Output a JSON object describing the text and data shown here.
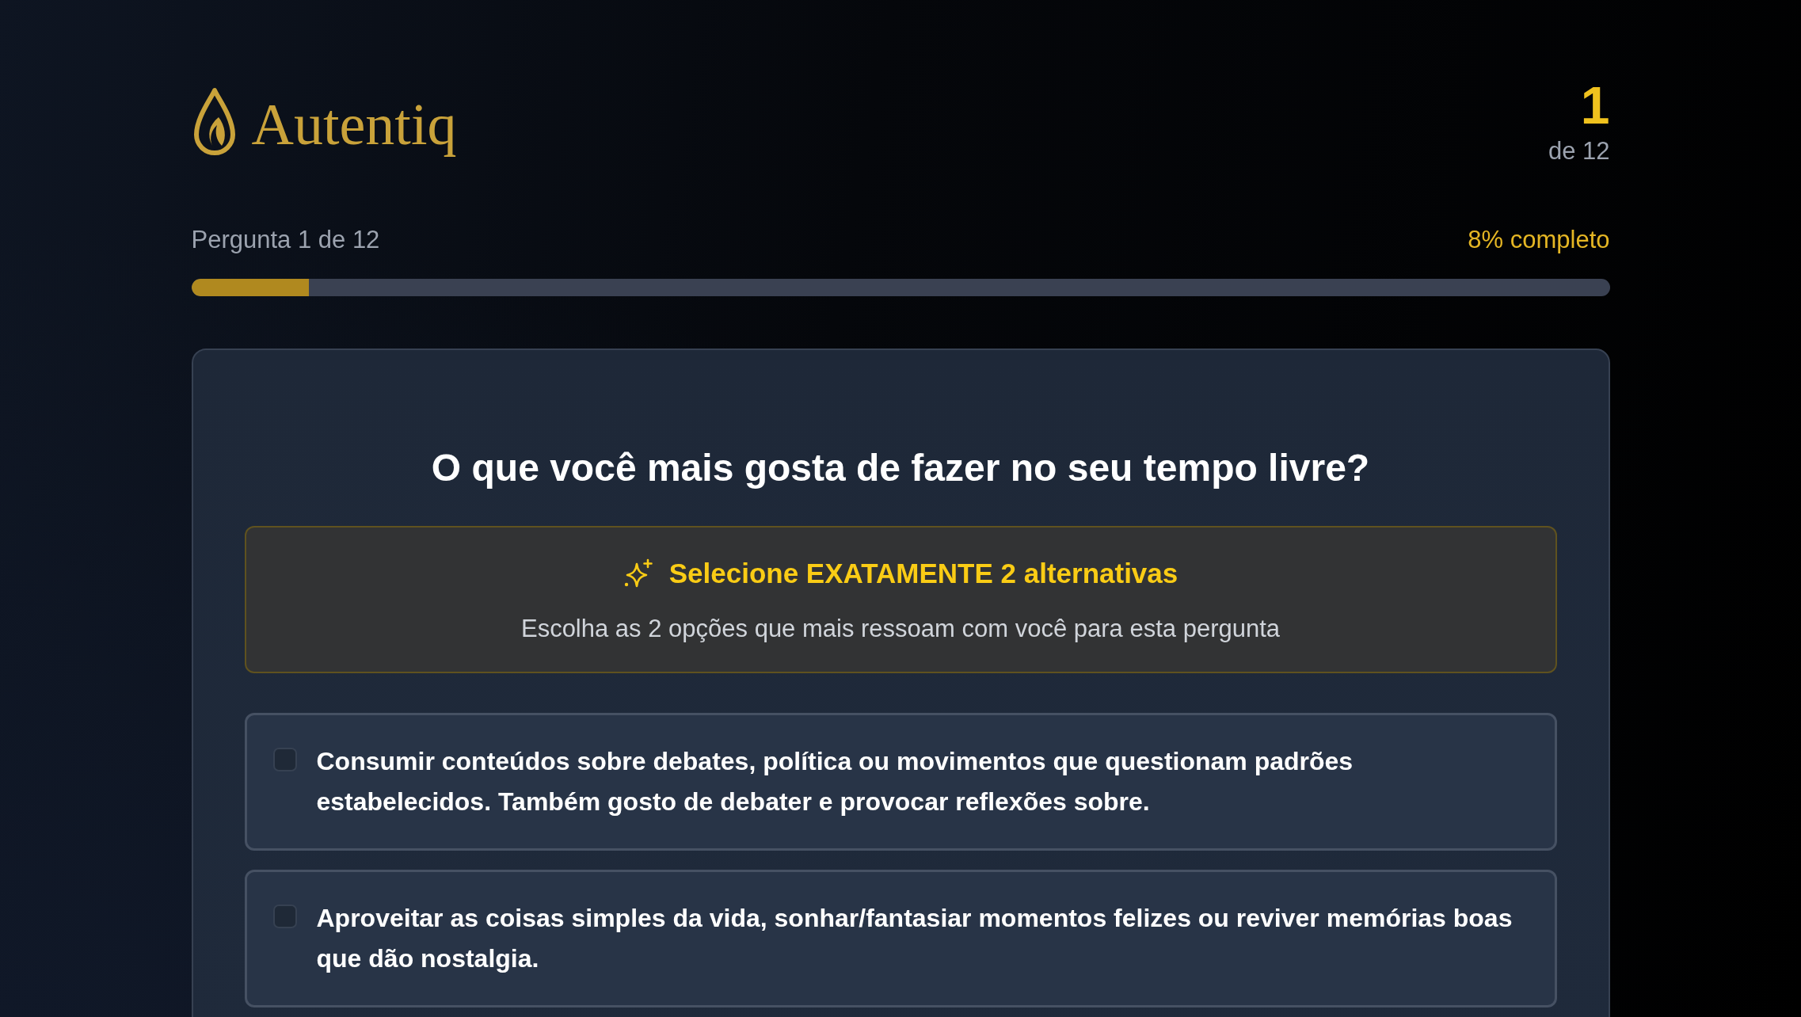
{
  "brand": {
    "name": "Autentiq"
  },
  "counter": {
    "current": "1",
    "total": "de 12"
  },
  "progress": {
    "label": "Pergunta 1 de 12",
    "percent": "8% completo",
    "level": 0.083
  },
  "question": {
    "title": "O que você mais gosta de fazer no seu tempo livre?",
    "instruction": {
      "title": "Selecione EXATAMENTE 2 alternativas",
      "text": "Escolha as 2 opções que mais ressoam com você para esta pergunta"
    },
    "options": [
      {
        "text": "Consumir conteúdos sobre debates, política ou movimentos que questionam padrões estabelecidos. Também gosto de debater e provocar reflexões sobre.",
        "checked": false
      },
      {
        "text": "Aproveitar as coisas simples da vida, sonhar/fantasiar momentos felizes ou reviver memórias boas que dão nostalgia.",
        "checked": false
      }
    ]
  }
}
